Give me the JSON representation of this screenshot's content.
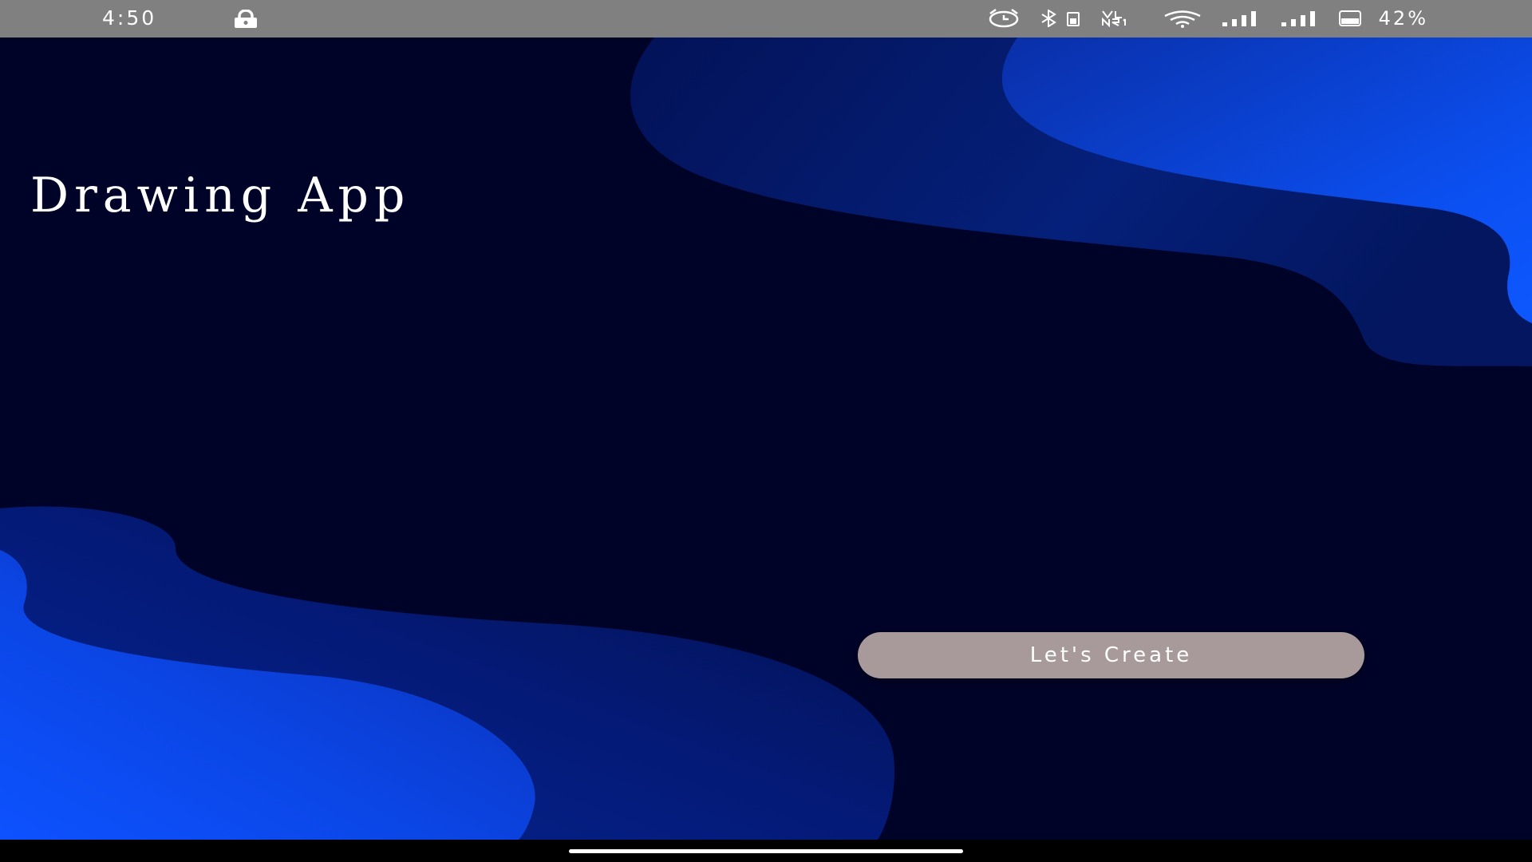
{
  "status_bar": {
    "time": "4:50",
    "battery_percent": "42%",
    "icons": [
      "lock-icon",
      "alarm-icon",
      "bluetooth-icon",
      "volte-icon",
      "wifi-icon",
      "signal-icon",
      "signal-icon",
      "battery-icon"
    ]
  },
  "app": {
    "title": "Drawing App",
    "cta_label": "Let's Create"
  },
  "colors": {
    "background": "#000328",
    "wave_light": "#0a4ff0",
    "wave_dark": "#031257",
    "button": "#a89a9a",
    "status_bar": "#808080"
  }
}
